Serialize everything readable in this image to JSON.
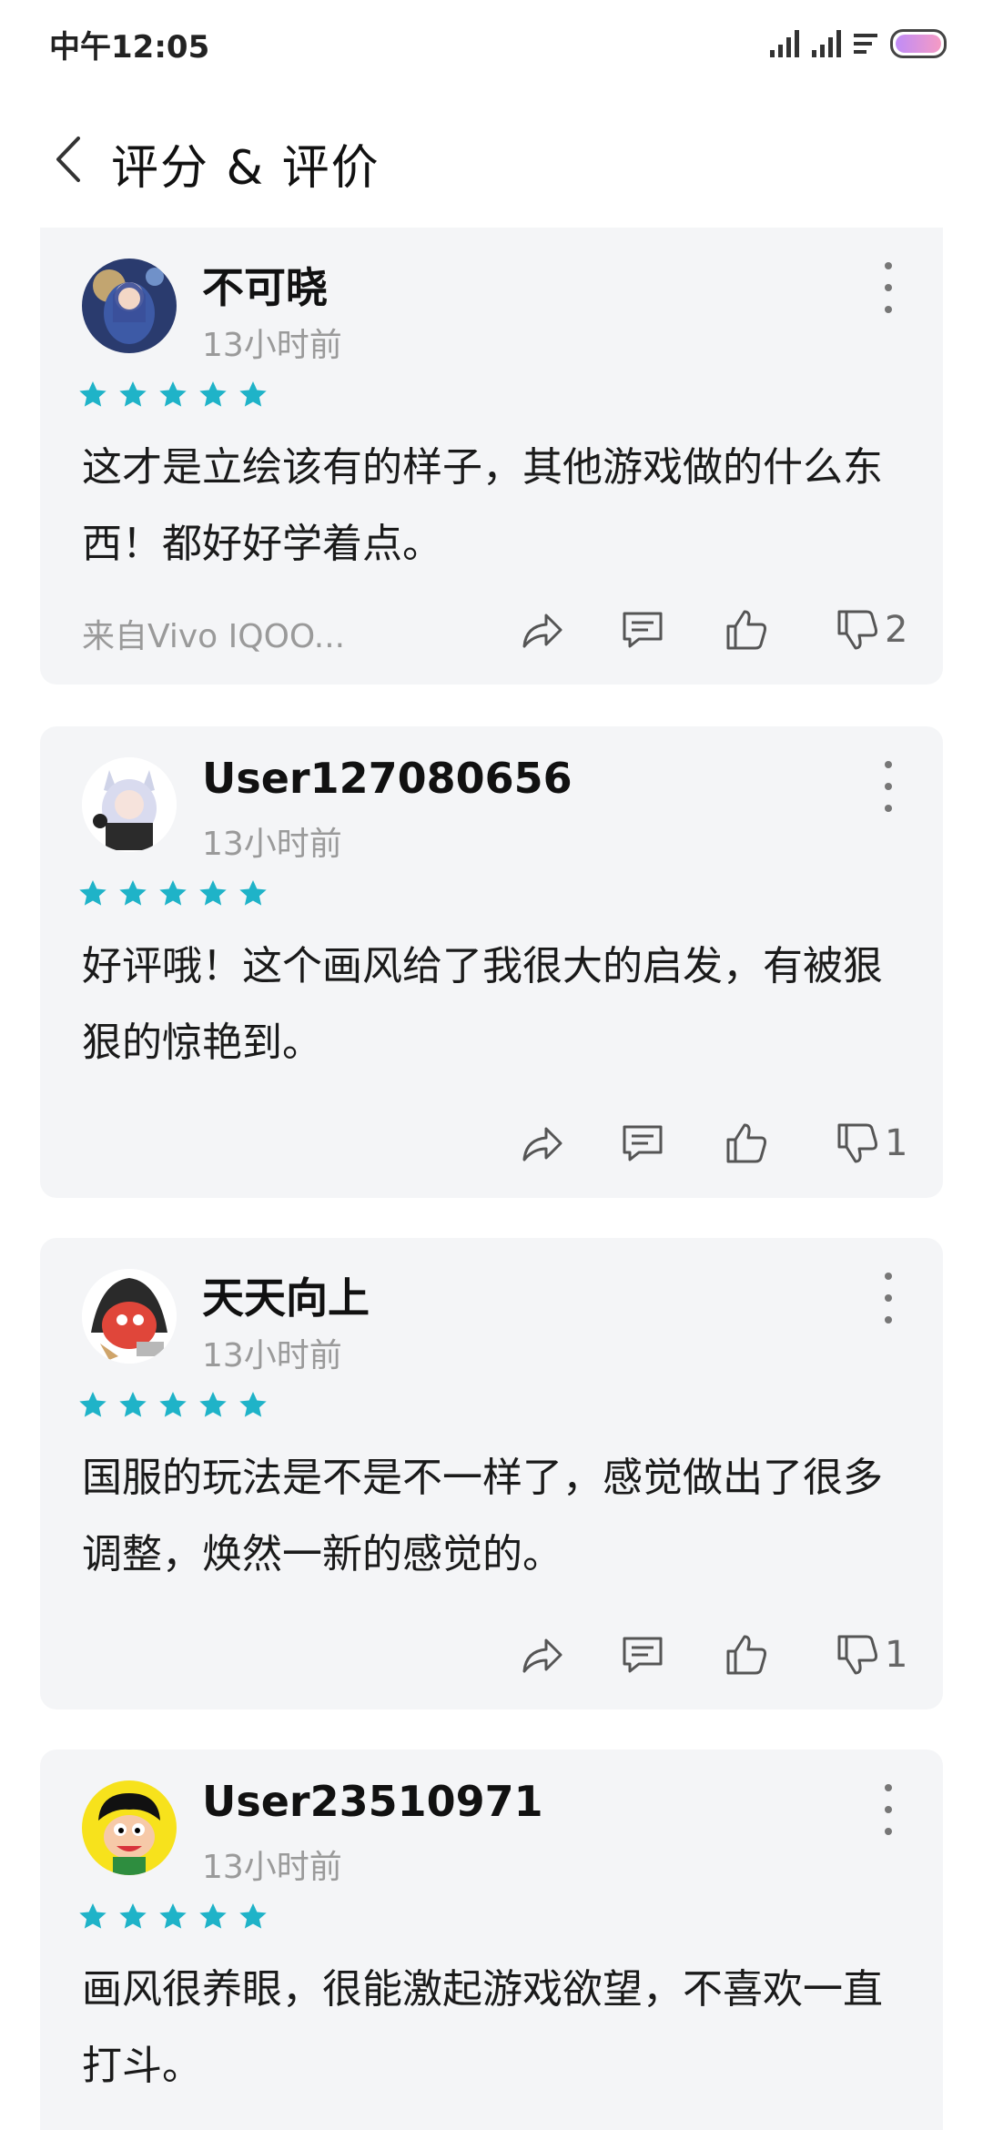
{
  "status_bar": {
    "time": "中午12:05"
  },
  "header": {
    "title": "评分 & 评价"
  },
  "reviews": [
    {
      "username": "不可晓",
      "time": "13小时前",
      "rating": 5,
      "content": "这才是立绘该有的样子，其他游戏做的什么东西！都好好学着点。",
      "device": "来自Vivo IQOO...",
      "dislikes": "2"
    },
    {
      "username": "User127080656",
      "time": "13小时前",
      "rating": 5,
      "content": "好评哦！这个画风给了我很大的启发，有被狠狠的惊艳到。",
      "dislikes": "1"
    },
    {
      "username": "天天向上",
      "time": "13小时前",
      "rating": 5,
      "content": "国服的玩法是不是不一样了，感觉做出了很多调整，焕然一新的感觉的。",
      "dislikes": "1"
    },
    {
      "username": "User23510971",
      "time": "13小时前",
      "rating": 5,
      "content": "画风很养眼，很能激起游戏欲望，不喜欢一直打斗。"
    }
  ],
  "colors": {
    "star": "#1fb3c8",
    "card_bg": "#f4f5f7",
    "meta_text": "#9a9a9a"
  }
}
